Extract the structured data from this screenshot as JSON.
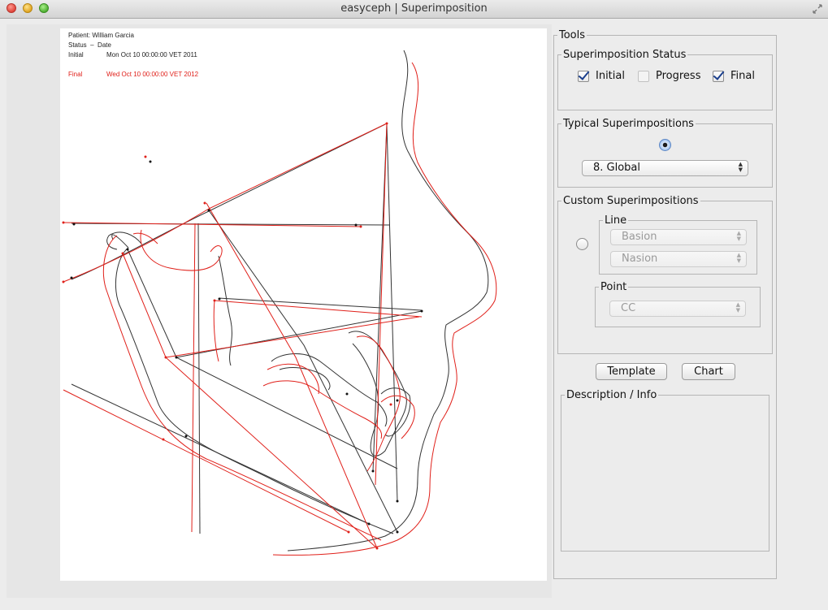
{
  "window": {
    "title": "easyceph | Superimposition"
  },
  "info": {
    "patient": "Patient: William Garcia",
    "status_label": "Status",
    "status_sep": "–",
    "date_label": "Date",
    "initial_label": "Initial",
    "initial_date": "Mon Oct 10 00:00:00 VET 2011",
    "final_label": "Final",
    "final_date": "Wed Oct 10 00:00:00 VET 2012"
  },
  "colors": {
    "initial_tracing": "#333333",
    "final_tracing": "#e0201a",
    "accent": "#5b86c5"
  },
  "tools": {
    "legend": "Tools",
    "status": {
      "legend": "Superimposition Status",
      "initial": {
        "label": "Initial",
        "checked": true
      },
      "progress": {
        "label": "Progress",
        "checked": false
      },
      "final": {
        "label": "Final",
        "checked": true
      }
    },
    "typical": {
      "legend": "Typical Superimpositions",
      "selected": true,
      "value": "8. Global"
    },
    "custom": {
      "legend": "Custom Superimpositions",
      "selected": false,
      "line": {
        "legend": "Line",
        "from": "Basion",
        "to": "Nasion"
      },
      "point": {
        "legend": "Point",
        "value": "CC"
      }
    },
    "buttons": {
      "template": "Template",
      "chart": "Chart"
    },
    "description": {
      "legend": "Description / Info"
    }
  }
}
